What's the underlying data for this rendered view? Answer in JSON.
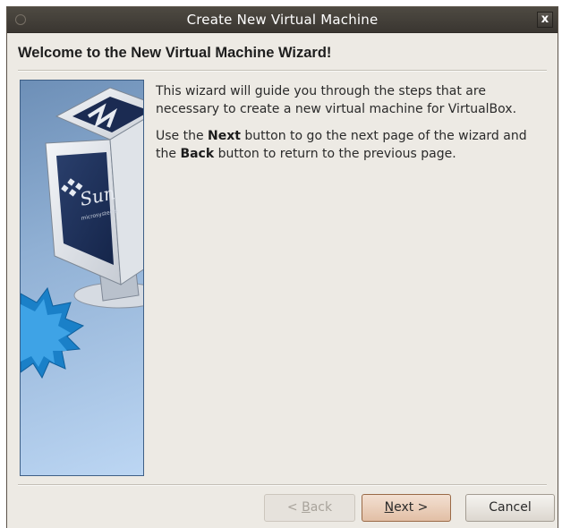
{
  "window": {
    "title": "Create New Virtual Machine",
    "close_glyph": "x",
    "icons": [
      "window-menu-icon",
      "close-icon"
    ]
  },
  "page": {
    "heading": "Welcome to the New Virtual Machine Wizard!",
    "paragraph1": "This wizard will guide you through the steps that are necessary to create a new virtual machine for VirtualBox.",
    "paragraph2": {
      "part1": "Use the ",
      "next_word": "Next",
      "part2": " button to go the next page of the wizard and the ",
      "back_word": "Back",
      "part3": " button to return to the previous page."
    },
    "side_image": {
      "icon": "virtualbox-sun-logo",
      "logo_text": "Sun",
      "logo_subtext": "microsystems"
    }
  },
  "buttons": {
    "back": {
      "prefix": "< ",
      "mnemonic": "B",
      "rest": "ack",
      "enabled": false
    },
    "next": {
      "mnemonic": "N",
      "rest": "ext >",
      "enabled": true,
      "focused": true
    },
    "cancel": {
      "label": "Cancel",
      "enabled": true
    }
  },
  "colors": {
    "titlebar": "#3f3b35",
    "dialog_bg": "#edeae4",
    "side_image_blue": "#90b0d4",
    "next_button": "#e2bfa5"
  }
}
